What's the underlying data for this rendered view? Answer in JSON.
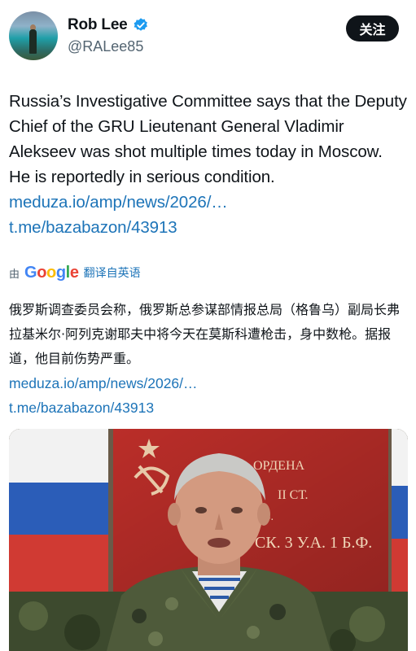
{
  "author": {
    "name": "Rob Lee",
    "handle": "@RALee85",
    "verified": true
  },
  "follow_button": "关注",
  "tweet": {
    "text": "Russia’s Investigative Committee says that the Deputy Chief of the GRU Lieutenant General Vladimir Alekseev was shot multiple times today in Moscow. He is reportedly in serious condition.",
    "links": [
      "meduza.io/amp/news/2026/…",
      "t.me/bazabazon/43913"
    ]
  },
  "translation": {
    "by_prefix": "由",
    "provider": "Google",
    "label": "翻译自英语",
    "text": "俄罗斯调查委员会称，俄罗斯总参谋部情报总局（格鲁乌）副局长弗拉基米尔·阿列克谢耶夫中将今天在莫斯科遭枪击，身中数枪。据报道，他目前伤势严重。",
    "links": [
      "meduza.io/amp/news/2026/…",
      "t.me/bazabazon/43913"
    ]
  },
  "media": {
    "banner_text_1": "ОРДЕНА",
    "banner_text_2": "II СТ.",
    "banner_text_3": "ИВ.",
    "banner_text_4": "СК. 3 У.А. 1 Б.Ф."
  },
  "colors": {
    "text": "#0f1419",
    "secondary": "#536471",
    "link": "#1d74b8",
    "verified": "#1d9bf0",
    "banner_red": "#c4302b"
  }
}
